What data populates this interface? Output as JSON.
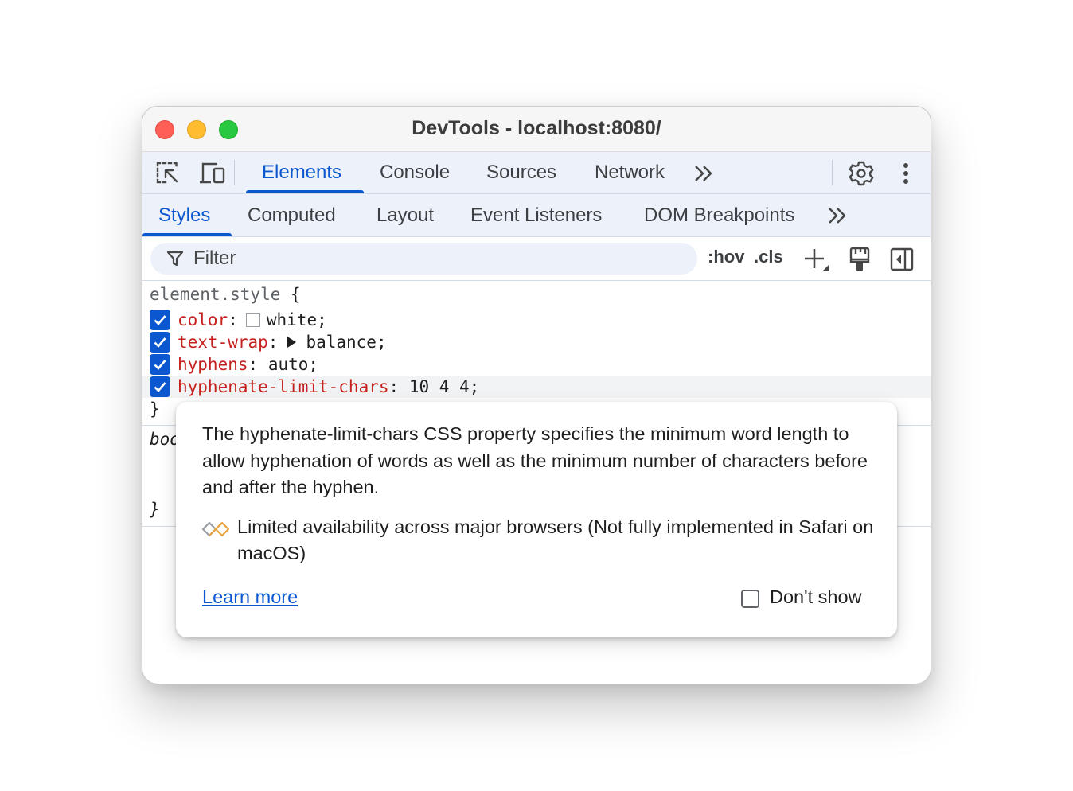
{
  "window": {
    "title": "DevTools - localhost:8080/"
  },
  "main_tabs": {
    "items": [
      "Elements",
      "Console",
      "Sources",
      "Network"
    ],
    "active": "Elements",
    "more_icon": "double-chevron-right-icon",
    "left_icons": [
      "select-element-icon",
      "device-toolbar-icon"
    ],
    "right_icons": [
      "gear-icon",
      "kebab-menu-icon"
    ]
  },
  "sub_tabs": {
    "items": [
      "Styles",
      "Computed",
      "Layout",
      "Event Listeners",
      "DOM Breakpoints"
    ],
    "active": "Styles",
    "more_icon": "double-chevron-right-icon"
  },
  "filter": {
    "placeholder": "Filter",
    "hov": ":hov",
    "cls": ".cls",
    "tool_icons": [
      "plus-icon",
      "paint-brush-icon",
      "toggle-sidebar-icon"
    ]
  },
  "styles": {
    "rule1": {
      "selector": "element.style",
      "open": " {",
      "close": "}",
      "declarations": [
        {
          "property": "color",
          "colon": ":",
          "value": "white;",
          "checked": true,
          "swatch": "#ffffff"
        },
        {
          "property": "text-wrap",
          "colon": ":",
          "value": "balance;",
          "checked": true
        },
        {
          "property": "hyphens",
          "colon": ": ",
          "value": "auto;",
          "checked": true
        },
        {
          "property": "hyphenate-limit-chars",
          "colon": ": ",
          "value": "10 4 4;",
          "checked": true
        }
      ]
    },
    "rule2": {
      "selector_partial": "boo",
      "close": "}"
    }
  },
  "popup": {
    "description": "The hyphenate-limit-chars CSS property specifies the minimum word length to allow hyphenation of words as well as the minimum number of characters before and after the hyphen.",
    "availability": "Limited availability across major browsers (Not fully implemented in Safari on macOS)",
    "availability_icon": "limited-availability-icon",
    "availability_color": "#e8a33d",
    "learn_more": "Learn more",
    "dont_show": "Don't show",
    "dont_show_checked": false
  },
  "colors": {
    "accent": "#0b57d0",
    "property": "#c5221f",
    "tab_bg": "#edf2fa"
  }
}
